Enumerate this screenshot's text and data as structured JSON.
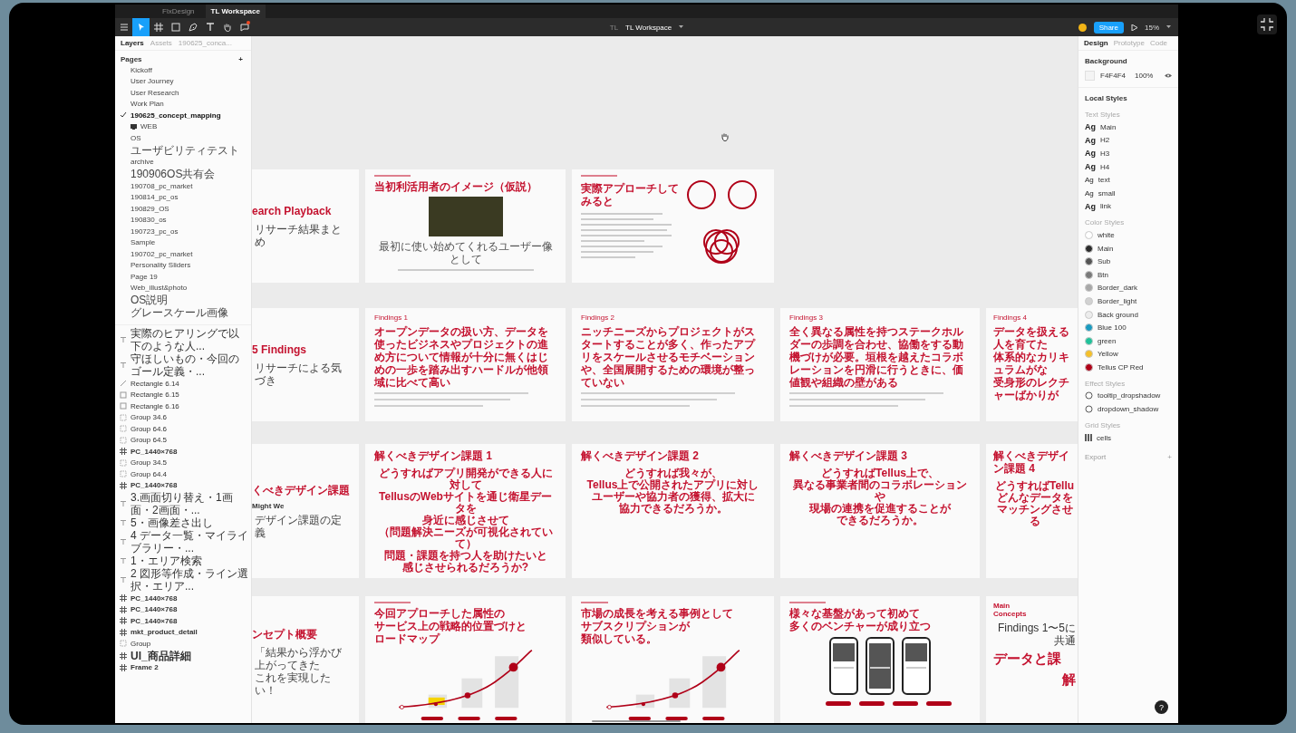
{
  "window": {
    "tabs": [
      {
        "label": "FlxDesign",
        "selected": false
      },
      {
        "label": "TL Workspace",
        "selected": true
      }
    ]
  },
  "toolbar": {
    "tools": [
      {
        "kind": "menu",
        "selected": false
      },
      {
        "kind": "move",
        "selected": true
      },
      {
        "kind": "frame",
        "selected": false
      },
      {
        "kind": "shape",
        "selected": false
      },
      {
        "kind": "pen",
        "selected": false
      },
      {
        "kind": "text",
        "selected": false
      },
      {
        "kind": "hand",
        "selected": false
      },
      {
        "kind": "comment",
        "selected": false,
        "notification": true
      }
    ],
    "team": "TL",
    "file_name": "TL Workspace",
    "share_label": "Share",
    "zoom": "15%"
  },
  "layers_panel": {
    "tabs": [
      {
        "label": "Layers",
        "selected": true
      },
      {
        "label": "Assets",
        "selected": false
      },
      {
        "label": "190625_conca...",
        "selected": false
      }
    ],
    "pages_title": "Pages",
    "add_label": "+",
    "pages": [
      {
        "name": "Kickoff",
        "selected": false
      },
      {
        "name": "User Journey",
        "selected": false
      },
      {
        "name": "User Research",
        "selected": false
      },
      {
        "name": "Work Plan",
        "selected": false
      },
      {
        "name": "190625_concept_mapping",
        "selected": true
      },
      {
        "name": "WEB",
        "selected": false,
        "emoji_icon": true
      },
      {
        "name": "OS",
        "selected": false
      },
      {
        "name": "ユーザビリティテスト",
        "selected": false
      },
      {
        "name": "archive",
        "selected": false
      },
      {
        "name": "190906OS共有会",
        "selected": false
      },
      {
        "name": "190708_pc_market",
        "selected": false
      },
      {
        "name": "190814_pc_os",
        "selected": false
      },
      {
        "name": "190829_OS",
        "selected": false
      },
      {
        "name": "190830_os",
        "selected": false
      },
      {
        "name": "190723_pc_os",
        "selected": false
      },
      {
        "name": "Sample",
        "selected": false
      },
      {
        "name": "190702_pc_market",
        "selected": false
      },
      {
        "name": "Personality Sliders",
        "selected": false
      },
      {
        "name": "Page 19",
        "selected": false
      },
      {
        "name": "Web_illust&photo",
        "selected": false
      },
      {
        "name": "OS説明",
        "selected": false
      },
      {
        "name": "グレースケール画像",
        "selected": false
      }
    ],
    "layers": [
      {
        "name": "実際のヒアリングで以下のような人...",
        "kind": "text"
      },
      {
        "name": "守ほしいもの・今回のゴール定義・...",
        "kind": "text"
      },
      {
        "name": "Rectangle 6.14",
        "kind": "line"
      },
      {
        "name": "Rectangle 6.15",
        "kind": "rect"
      },
      {
        "name": "Rectangle 6.16",
        "kind": "rect"
      },
      {
        "name": "Group 34.6",
        "kind": "group"
      },
      {
        "name": "Group 64.6",
        "kind": "group"
      },
      {
        "name": "Group 64.5",
        "kind": "group"
      },
      {
        "name": "PC_1440×768",
        "kind": "frame"
      },
      {
        "name": "Group 34.5",
        "kind": "group"
      },
      {
        "name": "Group 64.4",
        "kind": "group"
      },
      {
        "name": "PC_1440×768",
        "kind": "frame"
      },
      {
        "name": "3.画面切り替え・1画面・2画面・...",
        "kind": "text"
      },
      {
        "name": "5・画像差さ出し",
        "kind": "text"
      },
      {
        "name": "4 データ一覧・マイライブラリー・...",
        "kind": "text"
      },
      {
        "name": "1・エリア検索",
        "kind": "text"
      },
      {
        "name": "2 図形等作成・ライン選択・エリア...",
        "kind": "text"
      },
      {
        "name": "PC_1440×768",
        "kind": "frame"
      },
      {
        "name": "PC_1440×768",
        "kind": "frame"
      },
      {
        "name": "PC_1440×768",
        "kind": "frame"
      },
      {
        "name": "mkt_product_detail",
        "kind": "frame"
      },
      {
        "name": "Group",
        "kind": "group"
      },
      {
        "name": "UI_商品詳細",
        "kind": "frame"
      },
      {
        "name": "Frame 2",
        "kind": "frame"
      }
    ]
  },
  "canvas": {
    "rows": [
      {
        "frames": [
          {
            "kind": "section",
            "title": "earch Playback",
            "subtitle_lines": [
              "リサーチ結果まとめ"
            ]
          },
          {
            "kind": "photo_slide",
            "heading_lines": [
              "当初利活用者のイメージ（仮説）"
            ],
            "body": "最初に使い始めてくれるユーザー像として"
          },
          {
            "kind": "circles_slide",
            "heading_lines": [
              "実際アプローチしてみると"
            ]
          }
        ]
      },
      {
        "frames": [
          {
            "kind": "section",
            "title": "5 Findings",
            "subtitle_lines": [
              "リサーチによる気づき"
            ]
          },
          {
            "kind": "finding",
            "eyebrow": "Findings 1",
            "heading_lines": [
              "オープンデータの扱い方、データを使ったビジネスやプロジェクトの進め方について情報が十分に無くはじめの一歩を踏み出すハードルが他領域に比べて高い"
            ]
          },
          {
            "kind": "finding",
            "eyebrow": "Findings 2",
            "heading_lines": [
              "ニッチニーズからプロジェクトがスタートすることが多く、作ったアプリをスケールさせるモチベーションや、全国展開するための環境が整っていない"
            ]
          },
          {
            "kind": "finding",
            "eyebrow": "Findings 3",
            "heading_lines": [
              "全く異なる属性を持つステークホルダーの歩調を合わせ、協働をする動機づけが必要。垣根を越えたコラボレーションを円滑に行うときに、価値観や組織の壁がある"
            ]
          },
          {
            "kind": "finding",
            "eyebrow": "Findings 4",
            "heading_lines": [
              "データを扱える人を育てた",
              "体系的なカリキュラムがな",
              "受身形のレクチャーばかりが"
            ]
          }
        ]
      },
      {
        "frames": [
          {
            "kind": "section",
            "title": "くべきデザイン課題",
            "tag": "Might We",
            "subtitle_lines": [
              "デザイン課題の定義"
            ]
          },
          {
            "kind": "challenge",
            "heading": "解くべきデザイン課題 1",
            "question_lines": [
              "どうすればアプリ開発ができる人に対して",
              "TellusのWebサイトを通じ衛星データを",
              "身近に感じさせて",
              "（問題解決ニーズが可視化されていて）",
              "問題・課題を持つ人を助けたいと",
              "感じさせられるだろうか?"
            ]
          },
          {
            "kind": "challenge",
            "heading": "解くべきデザイン課題 2",
            "question_lines": [
              "どうすれば我々が、",
              "Tellus上で公開されたアプリに対し",
              "ユーザーや協力者の獲得、拡大に",
              "協力できるだろうか。"
            ]
          },
          {
            "kind": "challenge",
            "heading": "解くべきデザイン課題 3",
            "question_lines": [
              "どうすればTellus上で、",
              "異なる事業者間のコラボレーションや",
              "現場の連携を促進することが",
              "できるだろうか。"
            ]
          },
          {
            "kind": "challenge",
            "heading": "解くべきデザイン課題 4",
            "question_lines": [
              "どうすればTellu",
              "どんなデータを",
              "マッチングさせる"
            ]
          }
        ]
      },
      {
        "frames": [
          {
            "kind": "section",
            "title": "ンセプト概要",
            "subtitle_lines": [
              "「結果から浮かび上がってきた",
              "これを実現したい！"
            ]
          },
          {
            "kind": "roadmap_chart",
            "heading_lines": [
              "今回アプローチした属性の",
              "サービス上の戦略的位置づけと",
              "ロードマップ"
            ]
          },
          {
            "kind": "subscription_chart",
            "heading_lines": [
              "市場の成長を考える事例として",
              "サブスクリプションが",
              "類似している。"
            ]
          },
          {
            "kind": "phones",
            "heading_lines": [
              "様々な基盤があって初めて",
              "多くのベンチャーが成り立つ"
            ]
          },
          {
            "kind": "concept",
            "title": "Main\nConcepts",
            "note": "Findings 1〜5に共通",
            "headline": "データと課",
            "headline_2": "解"
          }
        ]
      }
    ]
  },
  "design_panel": {
    "tabs": [
      {
        "label": "Design",
        "selected": true
      },
      {
        "label": "Prototype",
        "selected": false
      },
      {
        "label": "Code",
        "selected": false
      }
    ],
    "background_title": "Background",
    "background_hex": "F4F4F4",
    "background_opacity": "100%",
    "local_styles_title": "Local Styles",
    "text_styles_title": "Text Styles",
    "text_styles": [
      {
        "sample": "Ag",
        "name": "Main",
        "kind": "strong"
      },
      {
        "sample": "Ag",
        "name": "H2",
        "kind": "strong"
      },
      {
        "sample": "Ag",
        "name": "H3",
        "kind": "strong"
      },
      {
        "sample": "Ag",
        "name": "H4",
        "kind": "strong"
      },
      {
        "sample": "Ag",
        "name": "text",
        "kind": "light"
      },
      {
        "sample": "Ag",
        "name": "small",
        "kind": "light"
      },
      {
        "sample": "Ag",
        "name": "link",
        "kind": "strong"
      }
    ],
    "color_styles_title": "Color Styles",
    "color_styles": [
      {
        "name": "white",
        "color": "#ffffff"
      },
      {
        "name": "Main",
        "color": "#2b2b2b"
      },
      {
        "name": "Sub",
        "color": "#555555"
      },
      {
        "name": "Btn",
        "color": "#7a7a7a"
      },
      {
        "name": "Border_dark",
        "color": "#a8a8a8"
      },
      {
        "name": "Border_light",
        "color": "#d2d2d2"
      },
      {
        "name": "Back ground",
        "color": "#ececec"
      },
      {
        "name": "Blue 100",
        "color": "#1a9bc0"
      },
      {
        "name": "green",
        "color": "#1fc29a"
      },
      {
        "name": "Yellow",
        "color": "#f5c02a"
      },
      {
        "name": "Tellus CP Red",
        "color": "#b00018"
      }
    ],
    "effect_styles_title": "Effect Styles",
    "effect_styles": [
      "tooltip_dropshadow",
      "dropdown_shadow"
    ],
    "grid_styles_title": "Grid Styles",
    "grid_styles": [
      "cells"
    ],
    "export_title": "Export",
    "export_add": "+",
    "help_label": "?"
  }
}
